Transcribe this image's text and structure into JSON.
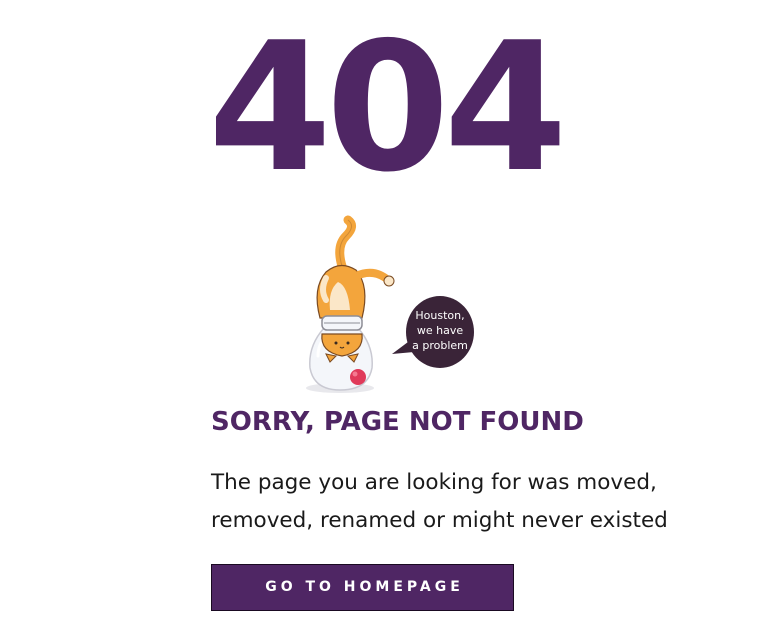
{
  "error": {
    "code": "404"
  },
  "illustration": {
    "icon": "cat-in-jar-illustration",
    "bubble_lines": [
      "Houston,",
      "we have",
      "a problem"
    ]
  },
  "content": {
    "title": "SORRY, PAGE NOT FOUND",
    "message_line1": "The page you are looking for was moved,",
    "message_line2": "removed, renamed or might never existed"
  },
  "actions": {
    "home_button_label": "GO TO HOMEPAGE"
  },
  "colors": {
    "brand_purple": "#4f2664",
    "cat_orange": "#f3a53c",
    "ball_red": "#e03a5a",
    "background": "#ffffff"
  }
}
